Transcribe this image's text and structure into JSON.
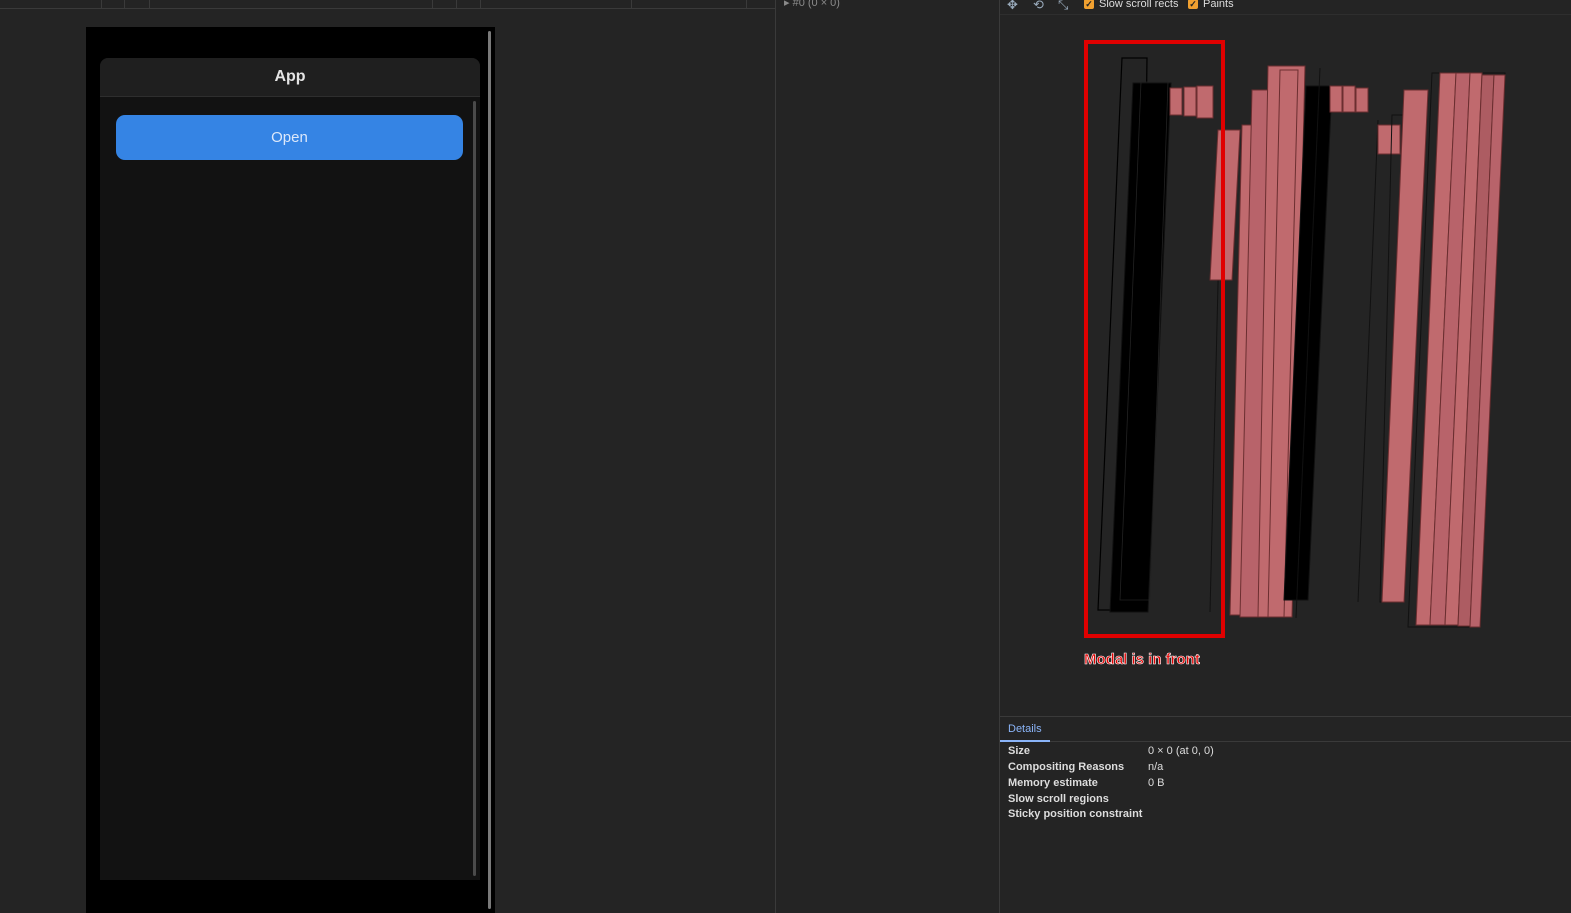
{
  "app": {
    "title": "App",
    "open_button_label": "Open"
  },
  "layers_tree": {
    "node_label": "▸ #0 (0 × 0)"
  },
  "toolbar": {
    "pan_icon": "pan-icon",
    "rotate_icon": "rotate-icon",
    "reset_icon": "reset-view-icon",
    "slow_scroll_label": "Slow scroll rects",
    "paints_label": "Paints",
    "slow_scroll_checked": true,
    "paints_checked": true
  },
  "annotation": {
    "label": "Modal is in front",
    "color": "#e00000"
  },
  "details": {
    "tab_label": "Details",
    "rows": [
      {
        "key": "Size",
        "value": "0 × 0 (at 0, 0)"
      },
      {
        "key": "Compositing Reasons",
        "value": "n/a"
      },
      {
        "key": "Memory estimate",
        "value": "0 B"
      },
      {
        "key": "Slow scroll regions",
        "value": ""
      },
      {
        "key": "Sticky position constraint",
        "value": ""
      }
    ]
  },
  "colors": {
    "accent_blue": "#3584e4",
    "layer_pink": "#c06a6e",
    "annotation_red": "#e00000"
  }
}
